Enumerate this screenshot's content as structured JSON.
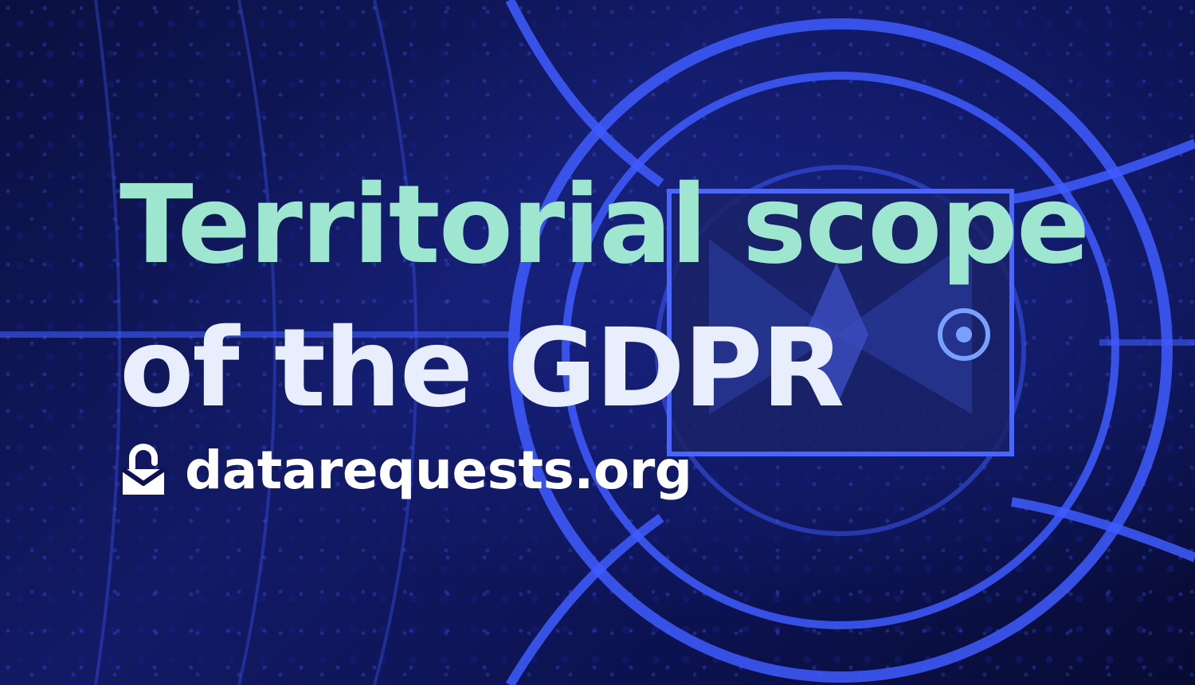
{
  "title": {
    "line1": "Territorial scope",
    "line2": "of the GDPR"
  },
  "brand": {
    "name": "datarequests.org",
    "logo_icon": "lock-envelope-icon"
  },
  "colors": {
    "title_line1": "#9ee6cf",
    "title_line2": "#e8eefc",
    "brand_text": "#ffffff",
    "background": "#0c1250",
    "roads": "#3f5cff"
  }
}
